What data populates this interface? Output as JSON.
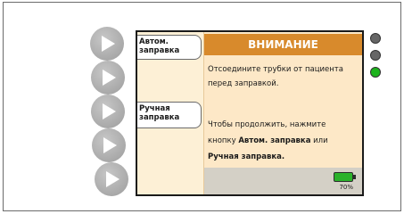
{
  "softkeys": {
    "key1": [
      "Автом.",
      "заправка"
    ],
    "key2": [
      "Ручная",
      "заправка"
    ]
  },
  "dialog": {
    "title": "ВНИМАНИЕ",
    "line1": "Отсоедините трубки от пациента",
    "line2": "перед заправкой.",
    "line3": "Чтобы продолжить, нажмите",
    "line4_prefix": "кнопку ",
    "line4_bold": "Автом. заправка",
    "line4_suffix": " или",
    "line5_bold": "Ручная заправка."
  },
  "battery": {
    "level_percent": 70,
    "text": "70%"
  },
  "colors": {
    "header": "#d88a2c",
    "screen_bg": "#fde8c7",
    "led_top": "#666666",
    "led_middle": "#666666",
    "led_bottom": "#1db31d",
    "battery": "#2bb22b"
  },
  "icons": {
    "side_buttons": "play-triangle-icon",
    "battery": "battery-icon"
  }
}
